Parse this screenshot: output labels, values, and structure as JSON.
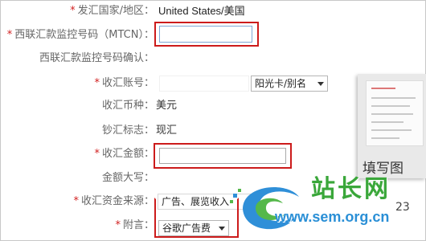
{
  "rows": [
    {
      "label": "发汇国家/地区",
      "required": true,
      "value": "United States/美国"
    },
    {
      "label": "西联汇款监控号码（MTCN）",
      "required": true
    },
    {
      "label": "西联汇款监控号码确认",
      "required": false
    },
    {
      "label": "收汇账号",
      "required": true,
      "select": "阳光卡/别名"
    },
    {
      "label": "收汇币种",
      "required": false,
      "value": "美元"
    },
    {
      "label": "钞汇标志",
      "required": false,
      "value": "现汇"
    },
    {
      "label": "收汇金额",
      "required": true
    },
    {
      "label": "金额大写",
      "required": false
    },
    {
      "label": "收汇资金来源",
      "required": true,
      "select": "广告、展览收入"
    },
    {
      "label": "附言",
      "required": true,
      "select": "谷歌广告费"
    }
  ],
  "colon": "：",
  "star": "*",
  "overlay": {
    "caption": "填写图",
    "watermark_title": "站长网",
    "watermark_url": "www.sem.org.cn",
    "watermark_num": "23"
  },
  "colors": {
    "required_star": "#d12020",
    "highlight_box": "#cc1b1b"
  }
}
